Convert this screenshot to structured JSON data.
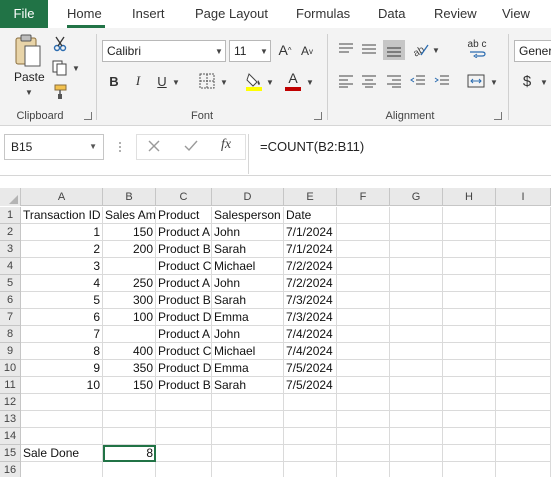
{
  "tabs": [
    "File",
    "Home",
    "Insert",
    "Page Layout",
    "Formulas",
    "Data",
    "Review",
    "View"
  ],
  "ribbon": {
    "clipboard": {
      "paste_label": "Paste",
      "group_label": "Clipboard"
    },
    "font": {
      "font_name": "Calibri",
      "font_size": "11",
      "bold": "B",
      "italic": "I",
      "underline": "U",
      "group_label": "Font",
      "highlight_color": "#ffff00",
      "font_color": "#c00000"
    },
    "alignment": {
      "group_label": "Alignment",
      "wrap_glyph": "ab c"
    },
    "number": {
      "format": "Gener",
      "currency": "$"
    }
  },
  "formula_bar": {
    "name_box": "B15",
    "fx_label": "fx",
    "formula": "=COUNT(B2:B11)"
  },
  "grid": {
    "columns": [
      "A",
      "B",
      "C",
      "D",
      "E",
      "F",
      "G",
      "H",
      "I"
    ],
    "row_numbers": [
      "1",
      "2",
      "3",
      "4",
      "5",
      "6",
      "7",
      "8",
      "9",
      "10",
      "11",
      "12",
      "13",
      "14",
      "15",
      "16"
    ],
    "rows": [
      [
        "Transaction ID",
        "Sales Am",
        "Product",
        "Salesperson",
        "Date"
      ],
      [
        "1",
        "150",
        "Product A",
        "John",
        "7/1/2024"
      ],
      [
        "2",
        "200",
        "Product B",
        "Sarah",
        "7/1/2024"
      ],
      [
        "3",
        "",
        "Product C",
        "Michael",
        "7/2/2024"
      ],
      [
        "4",
        "250",
        "Product A",
        "John",
        "7/2/2024"
      ],
      [
        "5",
        "300",
        "Product B",
        "Sarah",
        "7/3/2024"
      ],
      [
        "6",
        "100",
        "Product D",
        "Emma",
        "7/3/2024"
      ],
      [
        "7",
        "",
        "Product A",
        "John",
        "7/4/2024"
      ],
      [
        "8",
        "400",
        "Product C",
        "Michael",
        "7/4/2024"
      ],
      [
        "9",
        "350",
        "Product D",
        "Emma",
        "7/5/2024"
      ],
      [
        "10",
        "150",
        "Product B",
        "Sarah",
        "7/5/2024"
      ],
      [
        "",
        "",
        "",
        "",
        ""
      ],
      [
        "",
        "",
        "",
        "",
        ""
      ],
      [
        "",
        "",
        "",
        "",
        ""
      ],
      [
        "Sale Done",
        "8",
        "",
        "",
        ""
      ],
      [
        "",
        "",
        "",
        "",
        ""
      ]
    ]
  },
  "colors": {
    "accent": "#217346"
  }
}
